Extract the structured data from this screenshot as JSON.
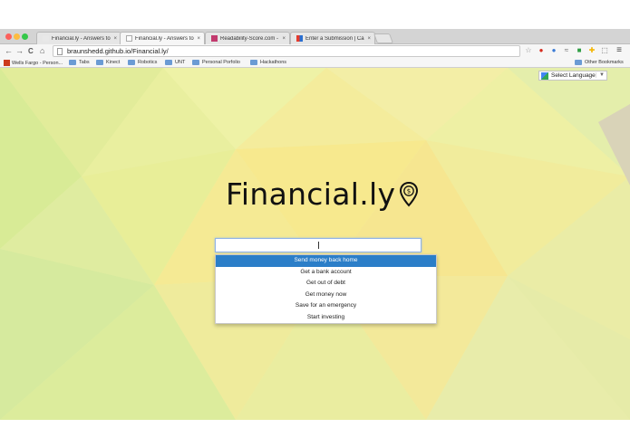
{
  "browser": {
    "tabs": [
      {
        "title": "Financial.ly - Answers to i...",
        "close": "×",
        "favicon_color": "#e8e8e8"
      },
      {
        "title": "Financial.ly - Answers to i...",
        "close": "×",
        "favicon_color": "#ffffff"
      },
      {
        "title": "Readability-Score.com - F...",
        "close": "×",
        "favicon_color": "#c23a6e"
      },
      {
        "title": "Enter a Submission | Capi...",
        "close": "×",
        "favicon_color": "#2a6fd1"
      }
    ],
    "nav": {
      "back": "←",
      "forward": "→",
      "reload": "C",
      "home": "⌂"
    },
    "url": "braunshedd.github.io/Financial.ly/",
    "extensions": [
      "☆",
      "●",
      "●",
      "≈",
      "■",
      "✚",
      "⬚",
      "≡"
    ],
    "bookmarks": [
      {
        "label": "Wells Fargo - Person...",
        "type": "site"
      },
      {
        "label": "Tabs",
        "type": "folder"
      },
      {
        "label": "Kinect",
        "type": "folder"
      },
      {
        "label": "Robotics",
        "type": "folder"
      },
      {
        "label": "UNT",
        "type": "folder"
      },
      {
        "label": "Personal Porfolio",
        "type": "folder"
      },
      {
        "label": "Hackathons",
        "type": "folder"
      }
    ],
    "other_bookmarks": "Other Bookmarks"
  },
  "page": {
    "translate": {
      "label": "Select Language",
      "caret": "▼"
    },
    "logo": {
      "name": "Financial",
      "suffix": ".ly",
      "icon": "location-pin-dollar-icon"
    },
    "search": {
      "value": ""
    },
    "suggestions": [
      "Send money back home",
      "Get a bank account",
      "Get out of debt",
      "Get money now",
      "Save for an emergency",
      "Start investing"
    ],
    "selected_suggestion": 0
  },
  "colors": {
    "accent": "#2b7ec8",
    "background": "#ecf0a8"
  }
}
